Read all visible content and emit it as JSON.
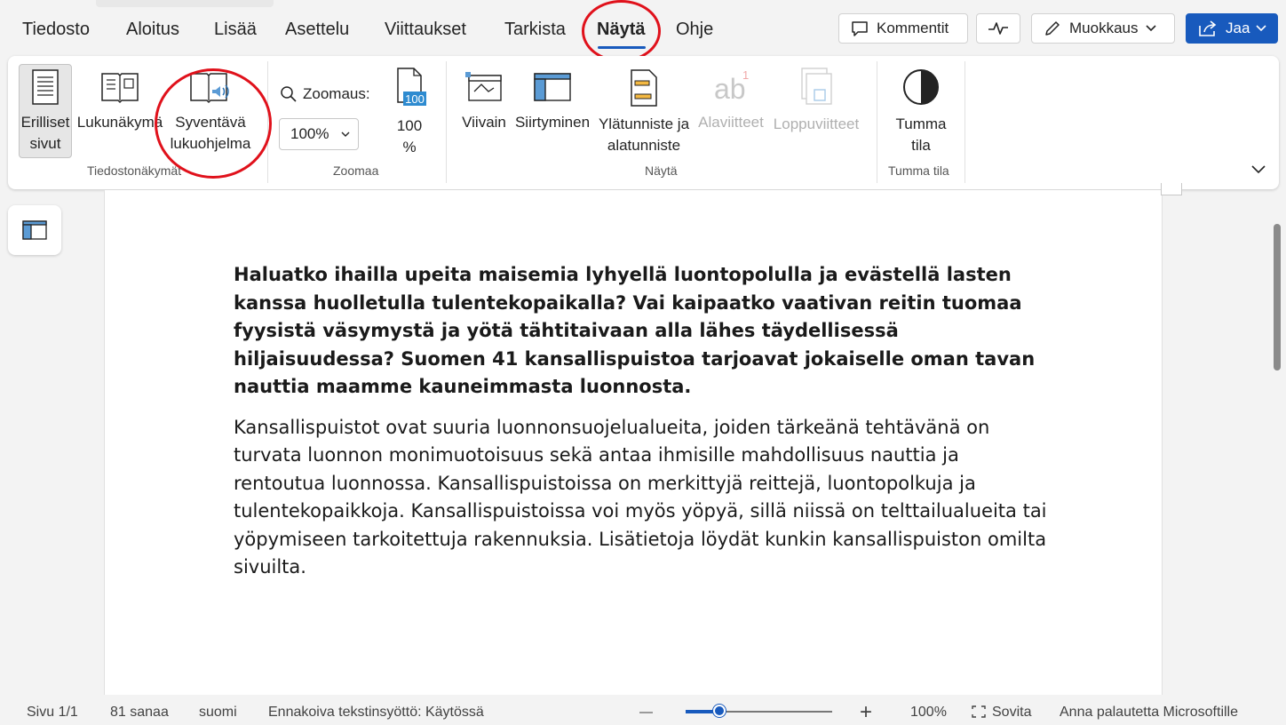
{
  "tabs": [
    "Tiedosto",
    "Aloitus",
    "Lisää",
    "Asettelu",
    "Viittaukset",
    "Tarkista",
    "Näytä",
    "Ohje"
  ],
  "active_tab": "Näytä",
  "top_buttons": {
    "comments": "Kommentit",
    "editing": "Muokkaus",
    "share": "Jaa"
  },
  "ribbon": {
    "views": {
      "group_label": "Tiedostonäkymät",
      "separate_pages": [
        "Erilliset",
        "sivut"
      ],
      "reading_view": "Lukunäkymä",
      "immersive_reader": [
        "Syventävä",
        "lukuohjelma"
      ]
    },
    "zoom": {
      "group_label": "Zoomaa",
      "zoom_label": "Zoomaus:",
      "zoom_value": "100%",
      "hundred_icon_text": "100",
      "hundred_button": [
        "100",
        "%"
      ]
    },
    "show": {
      "group_label": "Näytä",
      "ruler": "Viivain",
      "navigation": "Siirtyminen",
      "header_footer": [
        "Ylätunniste ja",
        "alatunniste"
      ],
      "footnotes": "Alaviitteet",
      "endnotes": "Loppuviitteet"
    },
    "dark": {
      "group_label": "Tumma tila",
      "dark_mode": [
        "Tumma",
        "tila"
      ]
    }
  },
  "document": {
    "lead": "Haluatko ihailla upeita maisemia lyhyellä luontopolulla ja evästellä lasten kanssa huolletulla tulentekopaikalla? Vai kaipaatko vaativan reitin tuomaa fyysistä väsymystä ja yötä tähtitaivaan alla lähes täydellisessä hiljaisuudessa? Suomen 41 kansallispuistoa tarjoavat jokaiselle oman tavan nauttia maamme kauneimmasta luonnosta.",
    "body": "Kansallispuistot ovat suuria luonnonsuojelualueita, joiden tärkeänä tehtävänä on turvata luonnon monimuotoisuus sekä antaa ihmisille mahdollisuus nauttia ja rentoutua luonnossa. Kansallispuistoissa on merkittyjä reittejä, luontopolkuja ja tulentekopaikkoja. Kansallispuistoissa voi myös yöpyä, sillä niissä on telttailualueita tai yöpymiseen tarkoitettuja rakennuksia. Lisätietoja löydät kunkin kansallispuiston omilta sivuilta."
  },
  "status": {
    "page": "Sivu 1/1",
    "words": "81 sanaa",
    "language": "suomi",
    "predictive": "Ennakoiva tekstinsyöttö: Käytössä",
    "zoom_minus": "—",
    "zoom_plus": "+",
    "zoom_percent": "100%",
    "zoom_level": 0.2,
    "fit": "Sovita",
    "feedback": "Anna palautetta Microsoftille"
  },
  "colors": {
    "accent": "#185abd",
    "annotation_circle": "#e0111b"
  }
}
